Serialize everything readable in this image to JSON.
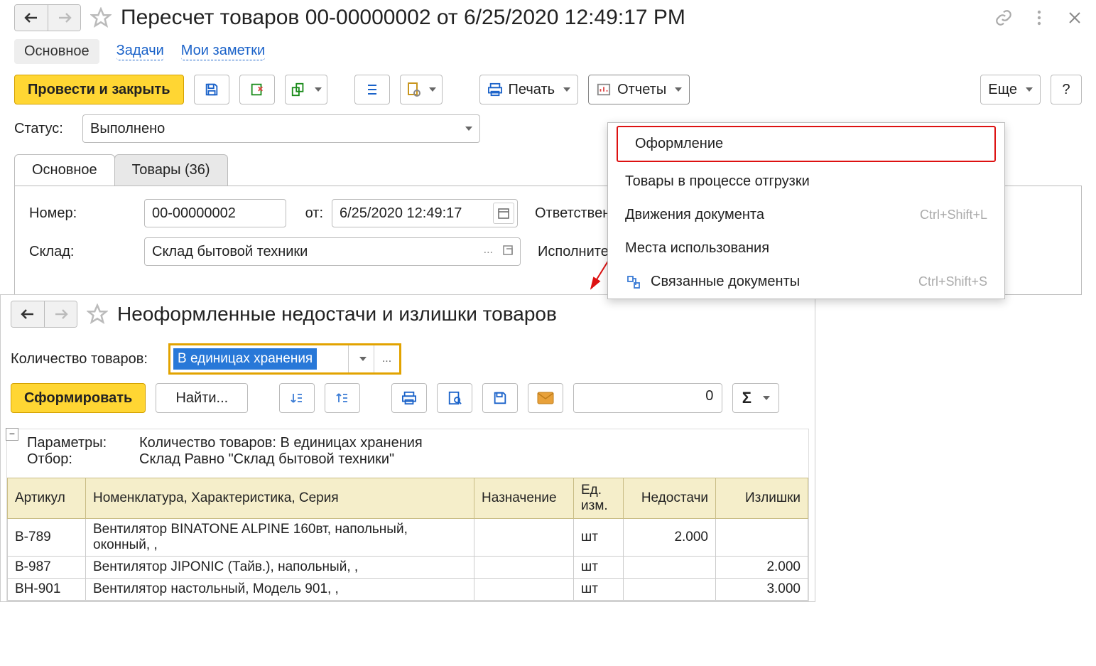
{
  "window1": {
    "title": "Пересчет товаров 00-00000002 от 6/25/2020 12:49:17 PM",
    "subnav": {
      "main": "Основное",
      "tasks": "Задачи",
      "notes": "Мои заметки"
    },
    "toolbar": {
      "post_close": "Провести и закрыть",
      "print": "Печать",
      "reports": "Отчеты",
      "more": "Еще",
      "help": "?"
    },
    "status_label": "Статус:",
    "status_value": "Выполнено",
    "tabs": {
      "main": "Основное",
      "goods": "Товары (36)"
    },
    "form": {
      "num_label": "Номер:",
      "num_value": "00-00000002",
      "from_label": "от:",
      "date_value": "6/25/2020 12:49:17",
      "resp_label": "Ответственный",
      "wh_label": "Склад:",
      "wh_value": "Склад бытовой техники",
      "exec_label": "Исполнитель:"
    },
    "dropdown": {
      "i1": "Оформление",
      "i2": "Товары в процессе отгрузки",
      "i3": "Движения документа",
      "i3_sh": "Ctrl+Shift+L",
      "i4": "Места использования",
      "i5": "Связанные документы",
      "i5_sh": "Ctrl+Shift+S"
    }
  },
  "window2": {
    "title": "Неоформленные недостачи и излишки товаров",
    "qty_label": "Количество товаров:",
    "qty_value": "В единицах хранения",
    "toolbar": {
      "form": "Сформировать",
      "find": "Найти...",
      "numbox": "0"
    },
    "params": {
      "p_label": "Параметры:",
      "p_value": "Количество товаров: В единицах хранения",
      "f_label": "Отбор:",
      "f_value": "Склад Равно \"Склад бытовой техники\""
    },
    "headers": {
      "art": "Артикул",
      "nom": "Номенклатура, Характеристика, Серия",
      "dest": "Назначение",
      "unit": "Ед. изм.",
      "short": "Недостачи",
      "over": "Излишки"
    },
    "rows": [
      {
        "art": "B-789",
        "nom": "Вентилятор BINATONE ALPINE 160вт, напольный, оконный, ,",
        "dest": "",
        "unit": "шт",
        "short": "2.000",
        "over": ""
      },
      {
        "art": "B-987",
        "nom": "Вентилятор JIPONIC (Тайв.), напольный, ,",
        "dest": "",
        "unit": "шт",
        "short": "",
        "over": "2.000"
      },
      {
        "art": "BH-901",
        "nom": "Вентилятор настольный, Модель 901, ,",
        "dest": "",
        "unit": "шт",
        "short": "",
        "over": "3.000"
      }
    ]
  }
}
